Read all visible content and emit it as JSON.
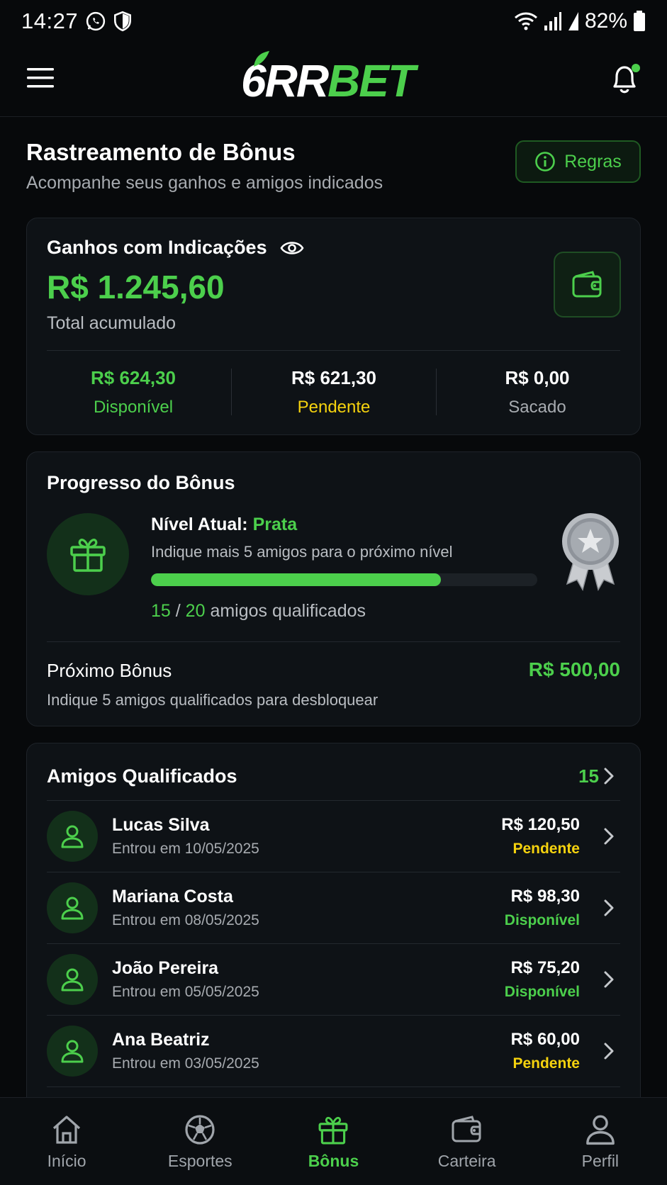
{
  "status_bar": {
    "time": "14:27",
    "battery": "82%"
  },
  "header": {
    "logo_prefix": "6",
    "logo_mid": "RR",
    "logo_suffix": "BET"
  },
  "page": {
    "title": "Rastreamento de Bônus",
    "subtitle": "Acompanhe seus ganhos e amigos indicados",
    "rules_label": "Regras"
  },
  "earnings": {
    "title": "Ganhos com Indicações",
    "amount": "R$ 1.245,60",
    "total_label": "Total acumulado",
    "stats": [
      {
        "value": "R$ 624,30",
        "label": "Disponível"
      },
      {
        "value": "R$ 621,30",
        "label": "Pendente"
      },
      {
        "value": "R$ 0,00",
        "label": "Sacado"
      }
    ]
  },
  "progress": {
    "title": "Progresso do Bônus",
    "level_prefix": "Nível Atual:",
    "level_name": "Prata",
    "hint": "Indique mais 5 amigos para o próximo nível",
    "current": "15",
    "separator": "/",
    "target": "20",
    "suffix": "amigos qualificados",
    "fraction": 0.75,
    "next_title": "Próximo Bônus",
    "next_amount": "R$ 500,00",
    "next_hint": "Indique 5 amigos qualificados para desbloquear"
  },
  "friends": {
    "title": "Amigos Qualificados",
    "count": "15",
    "items": [
      {
        "name": "Lucas Silva",
        "date": "Entrou em 10/05/2025",
        "amount": "R$ 120,50",
        "status": "Pendente"
      },
      {
        "name": "Mariana Costa",
        "date": "Entrou em 08/05/2025",
        "amount": "R$ 98,30",
        "status": "Disponível"
      },
      {
        "name": "João Pereira",
        "date": "Entrou em 05/05/2025",
        "amount": "R$ 75,20",
        "status": "Disponível"
      },
      {
        "name": "Ana Beatriz",
        "date": "Entrou em 03/05/2025",
        "amount": "R$ 60,00",
        "status": "Pendente"
      }
    ]
  },
  "nav": [
    {
      "label": "Início",
      "icon": "home-icon"
    },
    {
      "label": "Esportes",
      "icon": "soccer-ball-icon"
    },
    {
      "label": "Bônus",
      "icon": "gift-icon"
    },
    {
      "label": "Carteira",
      "icon": "wallet-icon"
    },
    {
      "label": "Perfil",
      "icon": "user-icon"
    }
  ],
  "colors": {
    "accent": "#4ccf4c",
    "pending": "#f5d20e",
    "background": "#07090b",
    "card": "#0e1216"
  }
}
